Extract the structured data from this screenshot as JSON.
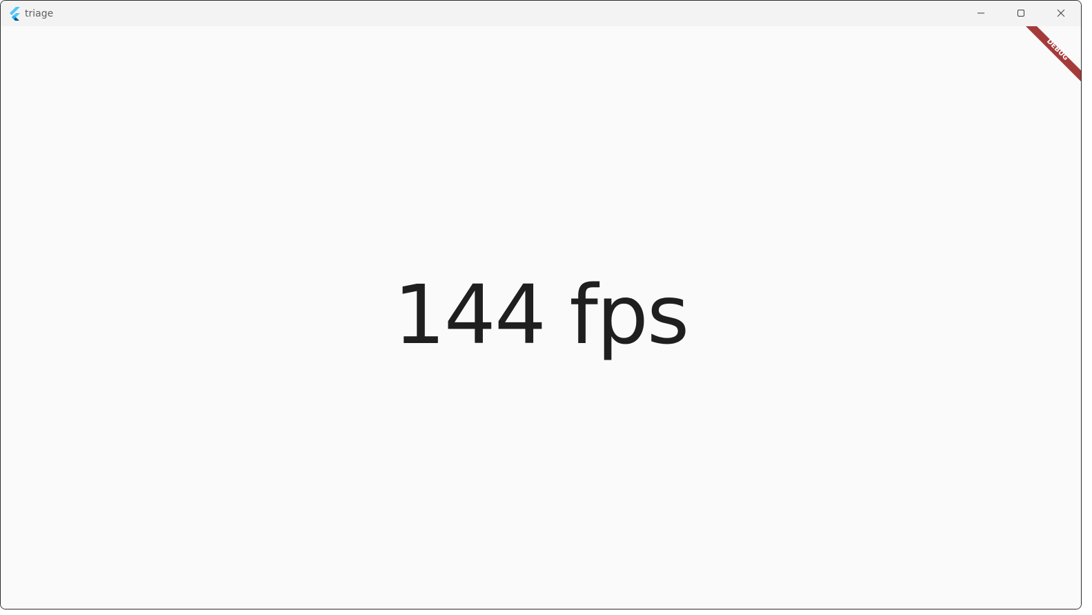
{
  "window": {
    "title": "triage",
    "app_icon": "flutter-logo-icon",
    "controls": {
      "minimize_icon": "minimize-icon",
      "maximize_icon": "maximize-icon",
      "close_icon": "close-icon"
    }
  },
  "main": {
    "fps_text": "144 fps"
  },
  "debug_banner": {
    "label": "DEBUG",
    "color": "#a43a3a"
  },
  "colors": {
    "background": "#fafafa",
    "titlebar": "#f3f3f3",
    "text": "#1f1f1f",
    "flutter_light": "#54c5f8",
    "flutter_dark": "#01579b"
  }
}
